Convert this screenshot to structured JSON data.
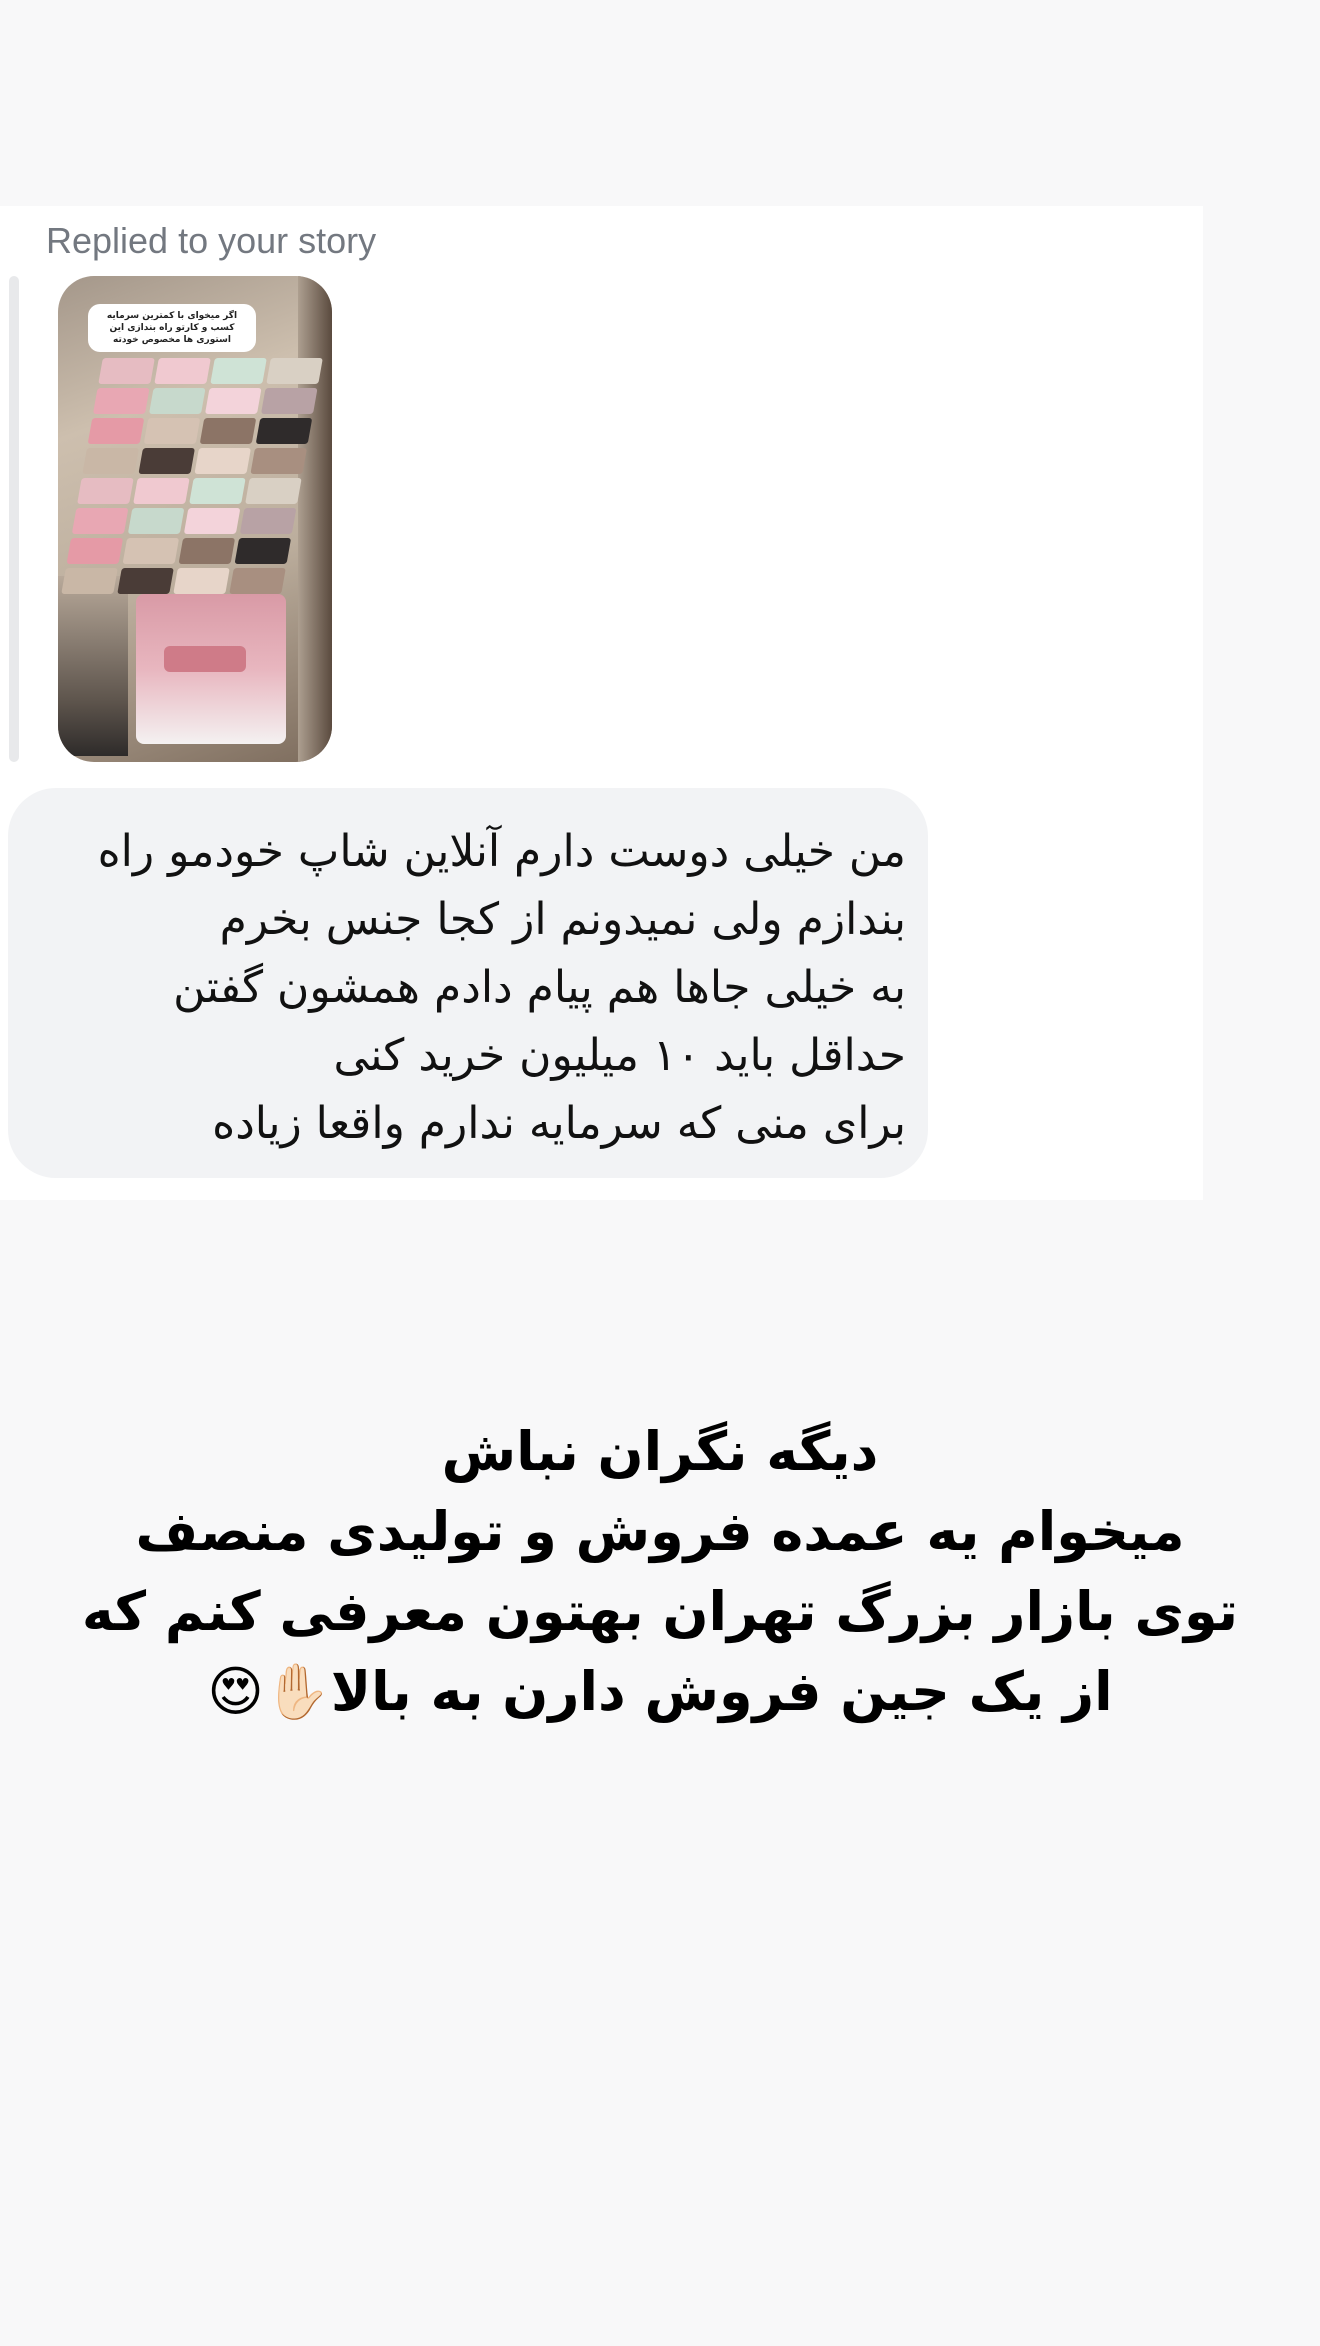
{
  "replied_label": "Replied to your story",
  "story": {
    "caption_lines": [
      "اگر میخوای با کمترین سرمایه",
      "کسب و کارتو راه بندازی این",
      "استوری ها مخصوص خودته"
    ]
  },
  "message": {
    "lines": [
      "من خیلی دوست دارم آنلاین شاپ خودمو راه",
      "بندازم ولی نمیدونم از کجا جنس بخرم",
      "به خیلی جاها هم پیام دادم همشون گفتن",
      "حداقل باید ۱۰ میلیون خرید کنی",
      "برای منی که سرمایه ندارم واقعا زیاده"
    ]
  },
  "overlay": {
    "lines": [
      "دیگه نگران نباش",
      "میخوام یه عمده فروش و تولیدی منصف",
      "توی بازار بزرگ تهران بهتون معرفی کنم که",
      "از یک جین فروش دارن به بالا✋🏻😍"
    ]
  },
  "colors": {
    "background": "#f8f8f9",
    "card": "#ffffff",
    "bubble": "#f2f3f5",
    "label": "#737880",
    "story_bar": "#e8e9eb"
  }
}
